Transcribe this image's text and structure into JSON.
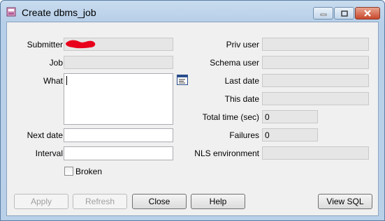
{
  "window": {
    "title": "Create dbms_job"
  },
  "left_fields": {
    "submitter": {
      "label": "Submitter",
      "value": ""
    },
    "job": {
      "label": "Job",
      "value": ""
    },
    "what": {
      "label": "What",
      "value": ""
    },
    "next_date": {
      "label": "Next date",
      "value": ""
    },
    "interval": {
      "label": "Interval",
      "value": ""
    },
    "broken": {
      "label": "Broken",
      "checked": false
    }
  },
  "right_fields": {
    "priv_user": {
      "label": "Priv user",
      "value": ""
    },
    "schema_user": {
      "label": "Schema user",
      "value": ""
    },
    "last_date": {
      "label": "Last date",
      "value": ""
    },
    "this_date": {
      "label": "This date",
      "value": ""
    },
    "total_time": {
      "label": "Total time (sec)",
      "value": "0"
    },
    "failures": {
      "label": "Failures",
      "value": "0"
    },
    "nls_environment": {
      "label": "NLS environment",
      "value": ""
    }
  },
  "buttons": {
    "apply": {
      "label": "Apply",
      "enabled": false
    },
    "refresh": {
      "label": "Refresh",
      "enabled": false
    },
    "close": {
      "label": "Close",
      "enabled": true
    },
    "help": {
      "label": "Help",
      "enabled": true
    },
    "view_sql": {
      "label": "View SQL",
      "enabled": true
    }
  },
  "colors": {
    "redaction": "#e8001c",
    "titlebar": "#b9d0e9",
    "client_bg": "#f0f0f0"
  }
}
